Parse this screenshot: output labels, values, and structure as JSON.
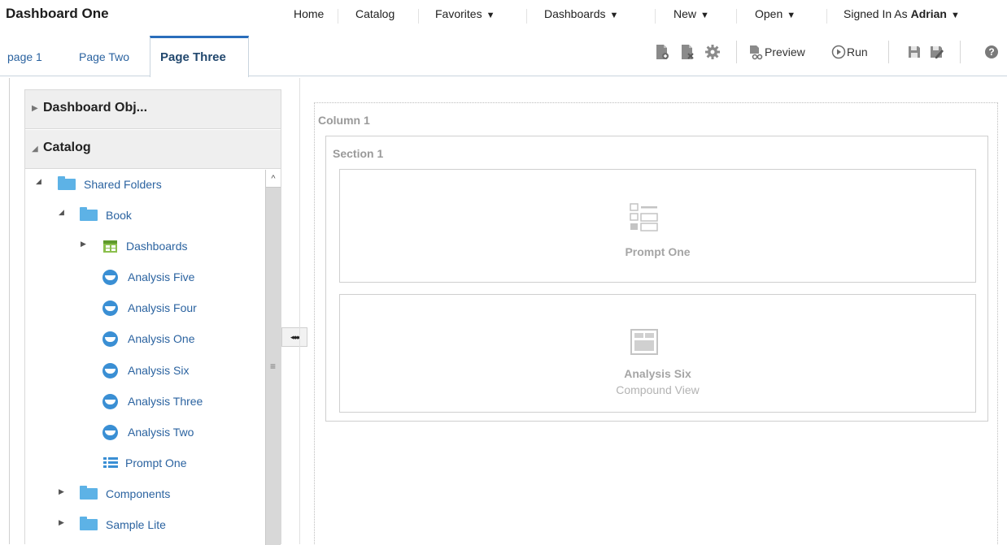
{
  "app": {
    "title": "Dashboard One"
  },
  "nav": {
    "home": "Home",
    "catalog": "Catalog",
    "favorites": "Favorites",
    "dashboards": "Dashboards",
    "new": "New",
    "open": "Open",
    "signed_in_label": "Signed In As",
    "user": "Adrian",
    "caret": "▼"
  },
  "tabs": [
    {
      "label": "page 1",
      "active": false
    },
    {
      "label": "Page Two",
      "active": false
    },
    {
      "label": "Page Three",
      "active": true
    }
  ],
  "toolbar": {
    "preview": "Preview",
    "run": "Run",
    "icons": [
      "add-page-icon",
      "delete-page-icon",
      "properties-gear-icon",
      "preview-icon",
      "run-icon",
      "save-icon",
      "save-as-icon",
      "help-icon"
    ]
  },
  "sidebar": {
    "objects_header": "Dashboard Obj...",
    "catalog_header": "Catalog",
    "tree": [
      {
        "label": "Shared Folders",
        "type": "folder",
        "level": 0,
        "expanded": true
      },
      {
        "label": "Book",
        "type": "folder",
        "level": 1,
        "expanded": true
      },
      {
        "label": "Dashboards",
        "type": "dashboard",
        "level": 2,
        "expanded": false
      },
      {
        "label": "Analysis Five",
        "type": "analysis",
        "level": 2
      },
      {
        "label": "Analysis Four",
        "type": "analysis",
        "level": 2
      },
      {
        "label": "Analysis One",
        "type": "analysis",
        "level": 2
      },
      {
        "label": "Analysis Six",
        "type": "analysis",
        "level": 2
      },
      {
        "label": "Analysis Three",
        "type": "analysis",
        "level": 2
      },
      {
        "label": "Analysis Two",
        "type": "analysis",
        "level": 2
      },
      {
        "label": "Prompt One",
        "type": "prompt",
        "level": 2
      },
      {
        "label": "Components",
        "type": "folder",
        "level": 1,
        "expanded": false
      },
      {
        "label": "Sample Lite",
        "type": "folder",
        "level": 1,
        "expanded": false
      }
    ],
    "collapse_glyph": "◂◂◂◂"
  },
  "canvas": {
    "column_title": "Column 1",
    "section_title": "Section 1",
    "objects": [
      {
        "label": "Prompt One",
        "sub": ""
      },
      {
        "label": "Analysis Six",
        "sub": "Compound View"
      }
    ]
  },
  "colors": {
    "link": "#2b63a0",
    "active_tab_border": "#2a6ebb",
    "folder": "#5db2e6",
    "placeholder_text": "#a5a5a5"
  }
}
